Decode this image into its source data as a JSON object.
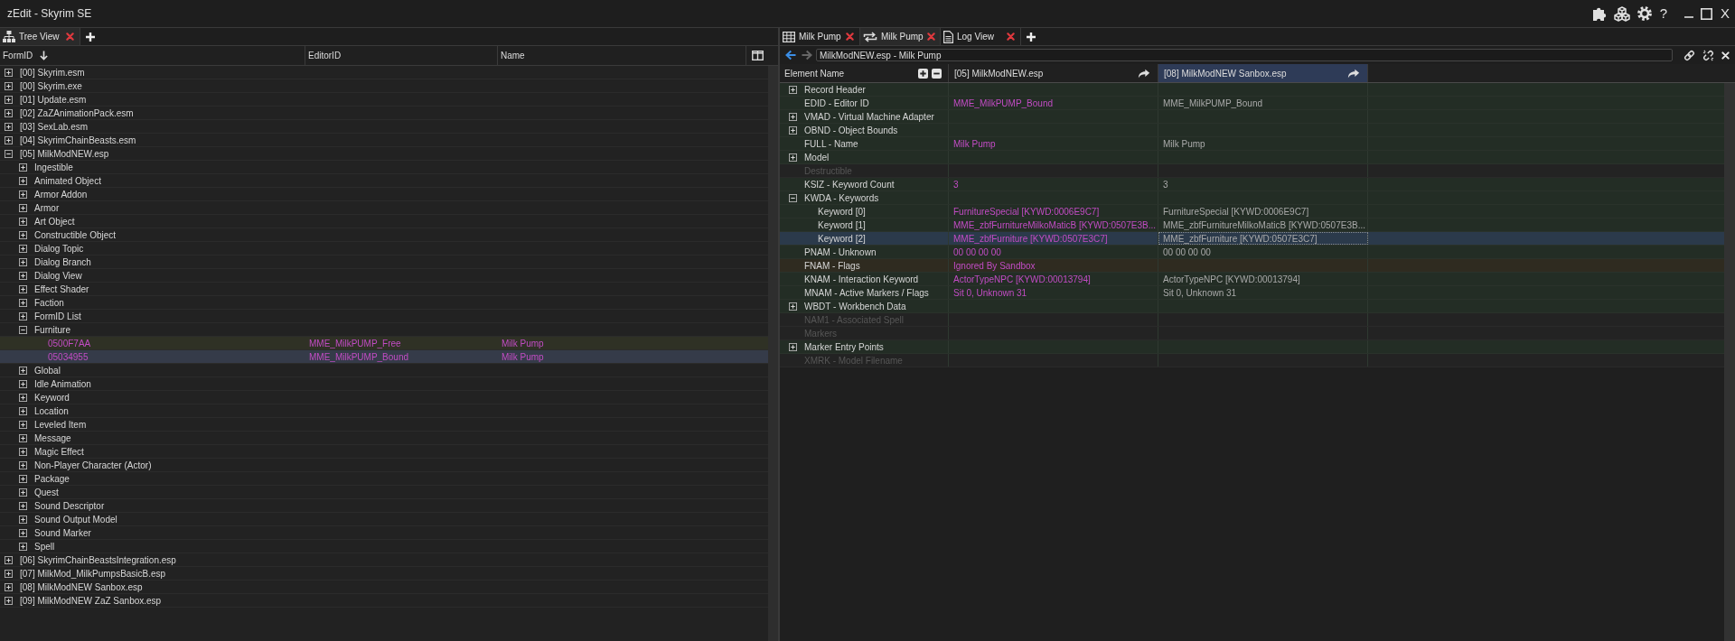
{
  "window": {
    "title": "zEdit - Skyrim SE",
    "help_label": "?",
    "close_label": "X"
  },
  "left_pane": {
    "tabs": [
      {
        "label": "Tree View",
        "kind": "tree",
        "selected": true
      }
    ],
    "columns": [
      {
        "label": "FormID",
        "sorted": true
      },
      {
        "label": "EditorID",
        "sorted": false
      },
      {
        "label": "Name",
        "sorted": false
      }
    ],
    "tree": [
      {
        "label": "[00] Skyrim.esm",
        "expanded": false,
        "selected": false
      },
      {
        "label": "[00] Skyrim.exe",
        "expanded": false,
        "selected": false
      },
      {
        "label": "[01] Update.esm",
        "expanded": false,
        "selected": false
      },
      {
        "label": "[02] ZaZAnimationPack.esm",
        "expanded": false,
        "selected": false
      },
      {
        "label": "[03] SexLab.esm",
        "expanded": false,
        "selected": false
      },
      {
        "label": "[04] SkyrimChainBeasts.esm",
        "expanded": false,
        "selected": false
      },
      {
        "label": "[05] MilkModNEW.esp",
        "expanded": true,
        "selected": false,
        "children": [
          {
            "label": "Ingestible",
            "expanded": false,
            "selected": false
          },
          {
            "label": "Animated Object",
            "expanded": false,
            "selected": false
          },
          {
            "label": "Armor Addon",
            "expanded": false,
            "selected": false
          },
          {
            "label": "Armor",
            "expanded": false,
            "selected": false
          },
          {
            "label": "Art Object",
            "expanded": false,
            "selected": false
          },
          {
            "label": "Constructible Object",
            "expanded": false,
            "selected": false
          },
          {
            "label": "Dialog Topic",
            "expanded": false,
            "selected": false
          },
          {
            "label": "Dialog Branch",
            "expanded": false,
            "selected": false
          },
          {
            "label": "Dialog View",
            "expanded": false,
            "selected": false
          },
          {
            "label": "Effect Shader",
            "expanded": false,
            "selected": false
          },
          {
            "label": "Faction",
            "expanded": false,
            "selected": false
          },
          {
            "label": "FormID List",
            "expanded": false,
            "selected": false
          },
          {
            "label": "Furniture",
            "expanded": true,
            "selected": false,
            "children": [
              {
                "form_id": "0500F7AA",
                "editor_id": "MME_MilkPUMP_Free",
                "name": "Milk Pump",
                "selected": false,
                "highlighted": true
              },
              {
                "form_id": "05034955",
                "editor_id": "MME_MilkPUMP_Bound",
                "name": "Milk Pump",
                "selected": true,
                "highlighted": false
              }
            ]
          },
          {
            "label": "Global",
            "expanded": false,
            "selected": false
          },
          {
            "label": "Idle Animation",
            "expanded": false,
            "selected": false
          },
          {
            "label": "Keyword",
            "expanded": false,
            "selected": false
          },
          {
            "label": "Location",
            "expanded": false,
            "selected": false
          },
          {
            "label": "Leveled Item",
            "expanded": false,
            "selected": false
          },
          {
            "label": "Message",
            "expanded": false,
            "selected": false
          },
          {
            "label": "Magic Effect",
            "expanded": false,
            "selected": false
          },
          {
            "label": "Non-Player Character (Actor)",
            "expanded": false,
            "selected": false
          },
          {
            "label": "Package",
            "expanded": false,
            "selected": false
          },
          {
            "label": "Quest",
            "expanded": false,
            "selected": false
          },
          {
            "label": "Sound Descriptor",
            "expanded": false,
            "selected": false
          },
          {
            "label": "Sound Output Model",
            "expanded": false,
            "selected": false
          },
          {
            "label": "Sound Marker",
            "expanded": false,
            "selected": false
          },
          {
            "label": "Spell",
            "expanded": false,
            "selected": false
          }
        ]
      },
      {
        "label": "[06] SkyrimChainBeastsIntegration.esp",
        "expanded": false,
        "selected": false
      },
      {
        "label": "[07] MilkMod_MilkPumpsBasicB.esp",
        "expanded": false,
        "selected": false
      },
      {
        "label": "[08] MilkModNEW Sanbox.esp",
        "expanded": false,
        "selected": false
      },
      {
        "label": "[09] MilkModNEW ZaZ Sanbox.esp",
        "expanded": false,
        "selected": false
      }
    ]
  },
  "right_pane": {
    "tabs": [
      {
        "label": "Milk Pump",
        "kind": "record",
        "selected": false
      },
      {
        "label": "Milk Pump",
        "kind": "compare",
        "selected": true
      },
      {
        "label": "Log View",
        "kind": "log",
        "selected": false
      }
    ],
    "navigation": {
      "back_enabled": true,
      "forward_enabled": false
    },
    "address": {
      "value": "MilkModNEW.esp - Milk Pump"
    },
    "element_column": "Element Name",
    "file_columns": [
      {
        "label": "[05] MilkModNEW.esp",
        "color": "#c24cc4",
        "selected": false
      },
      {
        "label": "[08] MilkModNEW Sanbox.esp",
        "color": "#a9a9a9",
        "selected": true
      }
    ],
    "rows": [
      {
        "label": "Record Header",
        "disabled": false,
        "conflict": false,
        "expanded": false,
        "selected": false
      },
      {
        "label": "EDID - Editor ID",
        "disabled": false,
        "conflict": false,
        "selected": false,
        "values": [
          "MME_MilkPUMP_Bound",
          "MME_MilkPUMP_Bound"
        ]
      },
      {
        "label": "VMAD - Virtual Machine Adapter",
        "disabled": false,
        "conflict": false,
        "expanded": false,
        "selected": false
      },
      {
        "label": "OBND - Object Bounds",
        "disabled": false,
        "conflict": false,
        "expanded": false,
        "selected": false
      },
      {
        "label": "FULL - Name",
        "disabled": false,
        "conflict": false,
        "selected": false,
        "values": [
          "Milk Pump",
          "Milk Pump"
        ]
      },
      {
        "label": "Model",
        "disabled": false,
        "conflict": false,
        "expanded": false,
        "selected": false
      },
      {
        "label": "Destructible",
        "disabled": true,
        "conflict": false,
        "selected": false
      },
      {
        "label": "KSIZ - Keyword Count",
        "disabled": false,
        "conflict": false,
        "selected": false,
        "values": [
          "3",
          "3"
        ]
      },
      {
        "label": "KWDA - Keywords",
        "disabled": false,
        "conflict": false,
        "expanded": true,
        "selected": false,
        "children": [
          {
            "label": "Keyword [0]",
            "disabled": false,
            "conflict": false,
            "selected": false,
            "values": [
              "FurnitureSpecial [KYWD:0006E9C7]",
              "FurnitureSpecial [KYWD:0006E9C7]"
            ]
          },
          {
            "label": "Keyword [1]",
            "disabled": false,
            "conflict": false,
            "selected": false,
            "values": [
              "MME_zbfFurnitureMilkoMaticB [KYWD:0507E3B...",
              "MME_zbfFurnitureMilkoMaticB [KYWD:0507E3B..."
            ]
          },
          {
            "label": "Keyword [2]",
            "disabled": false,
            "conflict": false,
            "selected": true,
            "values": [
              "MME_zbfFurniture [KYWD:0507E3C7]",
              "MME_zbfFurniture [KYWD:0507E3C7]"
            ],
            "focused_values": [
              false,
              true
            ]
          }
        ]
      },
      {
        "label": "PNAM - Unknown",
        "disabled": false,
        "conflict": false,
        "selected": false,
        "values": [
          "00 00 00 00",
          "00 00 00 00"
        ]
      },
      {
        "label": "FNAM - Flags",
        "disabled": false,
        "conflict": true,
        "selected": false,
        "values": [
          "Ignored By Sandbox"
        ]
      },
      {
        "label": "KNAM - Interaction Keyword",
        "disabled": false,
        "conflict": false,
        "selected": false,
        "values": [
          "ActorTypeNPC [KYWD:00013794]",
          "ActorTypeNPC [KYWD:00013794]"
        ]
      },
      {
        "label": "MNAM - Active Markers / Flags",
        "disabled": false,
        "conflict": false,
        "selected": false,
        "values": [
          "Sit 0, Unknown 31",
          "Sit 0, Unknown 31"
        ]
      },
      {
        "label": "WBDT - Workbench Data",
        "disabled": false,
        "conflict": false,
        "expanded": false,
        "selected": false
      },
      {
        "label": "NAM1 - Associated Spell",
        "disabled": true,
        "conflict": false,
        "selected": false
      },
      {
        "label": "Markers",
        "disabled": true,
        "conflict": false,
        "selected": false
      },
      {
        "label": "Marker Entry Points",
        "disabled": false,
        "conflict": false,
        "expanded": false,
        "selected": false
      },
      {
        "label": "XMRK - Model Filename",
        "disabled": true,
        "conflict": false,
        "selected": false
      }
    ]
  }
}
